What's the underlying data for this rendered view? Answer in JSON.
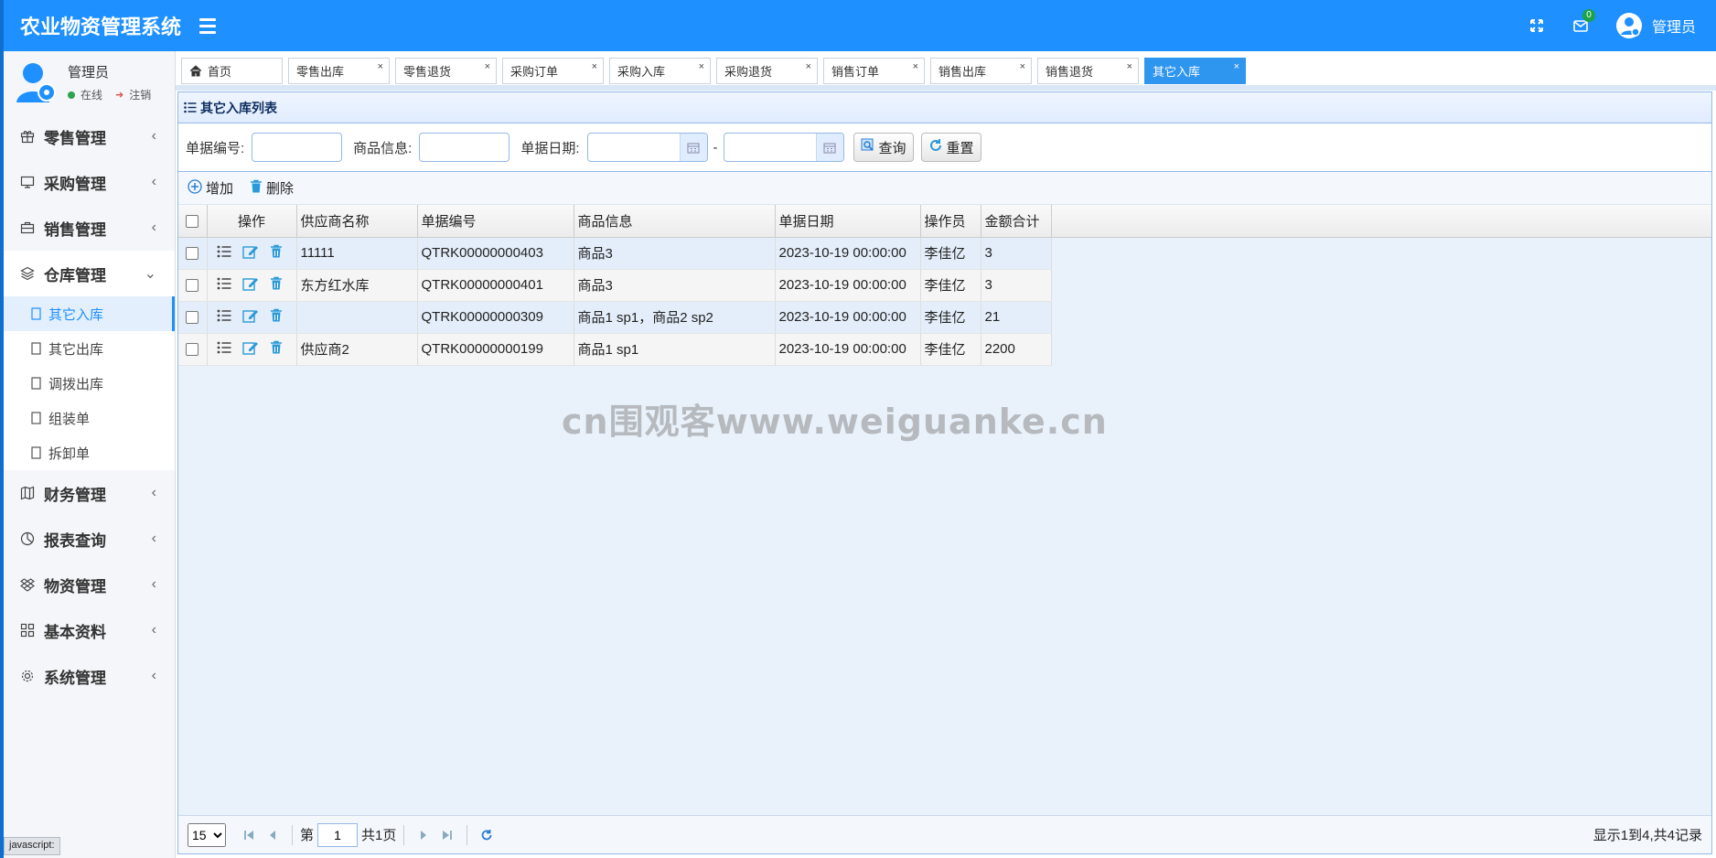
{
  "header": {
    "app_title": "农业物资管理系统",
    "mail_count": "0",
    "user_name": "管理员"
  },
  "sidebar": {
    "user": {
      "name": "管理员",
      "status": "在线",
      "logout": "注销"
    },
    "groups": [
      {
        "label": "零售管理",
        "icon": "gift-icon"
      },
      {
        "label": "采购管理",
        "icon": "monitor-icon"
      },
      {
        "label": "销售管理",
        "icon": "briefcase-icon"
      },
      {
        "label": "仓库管理",
        "icon": "layers-icon"
      },
      {
        "label": "财务管理",
        "icon": "map-icon"
      },
      {
        "label": "报表查询",
        "icon": "pie-chart-icon"
      },
      {
        "label": "物资管理",
        "icon": "dropbox-icon"
      },
      {
        "label": "基本资料",
        "icon": "grid-icon"
      },
      {
        "label": "系统管理",
        "icon": "gear-icon"
      }
    ],
    "warehouse_items": [
      "其它入库",
      "其它出库",
      "调拨出库",
      "组装单",
      "拆卸单"
    ]
  },
  "tabs": [
    "首页",
    "零售出库",
    "零售退货",
    "采购订单",
    "采购入库",
    "采购退货",
    "销售订单",
    "销售出库",
    "销售退货",
    "其它入库"
  ],
  "panel": {
    "title": "其它入库列表"
  },
  "search": {
    "doc_no_label": "单据编号:",
    "product_label": "商品信息:",
    "date_label": "单据日期:",
    "date_sep": "-",
    "query_btn": "查询",
    "reset_btn": "重置"
  },
  "toolbar": {
    "add": "增加",
    "delete": "删除"
  },
  "table": {
    "columns": [
      "操作",
      "供应商名称",
      "单据编号",
      "商品信息",
      "单据日期",
      "操作员",
      "金额合计"
    ],
    "rows": [
      {
        "supplier": "11111",
        "doc_no": "QTRK00000000403",
        "product": "商品3",
        "date": "2023-10-19 00:00:00",
        "operator": "李佳亿",
        "amount": "3"
      },
      {
        "supplier": "东方红水库",
        "doc_no": "QTRK00000000401",
        "product": "商品3",
        "date": "2023-10-19 00:00:00",
        "operator": "李佳亿",
        "amount": "3"
      },
      {
        "supplier": "",
        "doc_no": "QTRK00000000309",
        "product": "商品1 sp1，商品2 sp2",
        "date": "2023-10-19 00:00:00",
        "operator": "李佳亿",
        "amount": "21"
      },
      {
        "supplier": "供应商2",
        "doc_no": "QTRK00000000199",
        "product": "商品1 sp1",
        "date": "2023-10-19 00:00:00",
        "operator": "李佳亿",
        "amount": "2200"
      }
    ]
  },
  "watermark": "cn围观客www.weiguanke.cn",
  "pager": {
    "page_size": "15",
    "page_prefix": "第",
    "page_value": "1",
    "page_total": "共1页",
    "summary": "显示1到4,共4记录"
  },
  "statusbar": "javascript:"
}
